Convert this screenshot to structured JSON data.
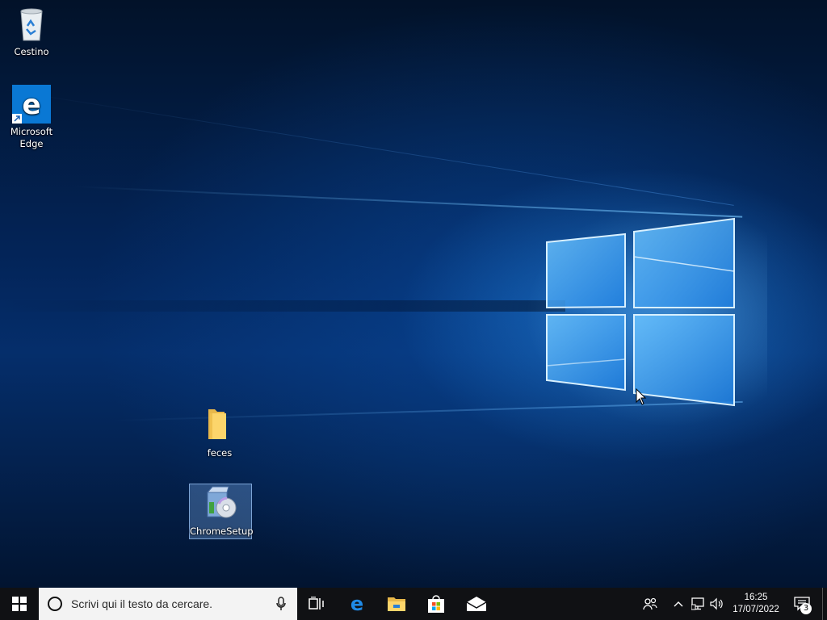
{
  "desktop": {
    "icons": [
      {
        "label": "Cestino",
        "icon": "recycle-bin-icon"
      },
      {
        "label": "Microsoft\nEdge",
        "icon": "edge-icon"
      },
      {
        "label": "feces",
        "icon": "folder-icon"
      },
      {
        "label": "ChromeSetup",
        "icon": "installer-icon"
      }
    ]
  },
  "taskbar": {
    "search_placeholder": "Scrivi qui il testo da cercare.",
    "pinned": [
      "task-view-icon",
      "edge-icon",
      "file-explorer-icon",
      "store-icon",
      "mail-icon"
    ],
    "clock": {
      "time": "16:25",
      "date": "17/07/2022"
    },
    "notifications_count": "3"
  },
  "colors": {
    "taskbar_bg": "#101114",
    "search_bg": "#f3f3f3",
    "accent": "#0078d7"
  }
}
